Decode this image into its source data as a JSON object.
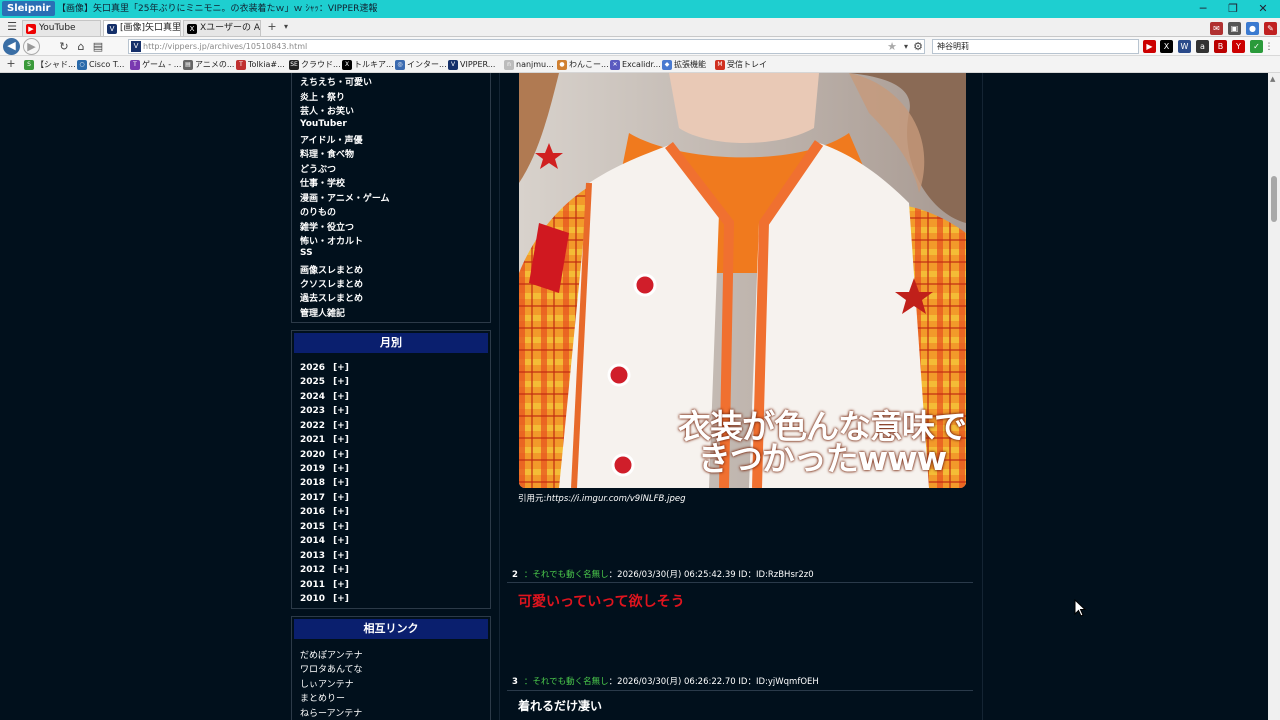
{
  "titlebar": {
    "app_name": "Sleipnir",
    "title": "【画像】矢口真里「25年ぶりにミニモニ。の衣装着たｗ」ｗ ｼｬｯ：VIPPER速報",
    "min": "─",
    "max": "❐",
    "close": "✕"
  },
  "tabs": [
    {
      "label": "YouTube",
      "active": false
    },
    {
      "label": "[画像]矢口真里...",
      "active": true
    },
    {
      "label": "Xユーザーの ABE...",
      "active": false
    }
  ],
  "tabbar": {
    "new_tab": "+",
    "menu": "▾"
  },
  "nav": {
    "url": "http://vippers.jp/archives/10510843.html",
    "search_value": "神谷明莉"
  },
  "bookmarks": [
    {
      "label": "【シャド..."
    },
    {
      "label": "Cisco T..."
    },
    {
      "label": "ゲーム - ..."
    },
    {
      "label": "アニメの..."
    },
    {
      "label": "Tolkia#..."
    },
    {
      "label": "クラウド..."
    },
    {
      "label": "トルキア..."
    },
    {
      "label": "インター..."
    },
    {
      "label": "VIPPER..."
    },
    {
      "label": "nanjmu..."
    },
    {
      "label": "わんこー..."
    },
    {
      "label": "Excalidr..."
    },
    {
      "label": "拡張機能"
    },
    {
      "label": "受信トレイ"
    }
  ],
  "sidebar": {
    "categories": [
      "えちえち・可愛い",
      "炎上・祭り",
      "芸人・お笑い",
      "YouTuber",
      "アイドル・声優",
      "料理・食べ物",
      "どうぶつ",
      "仕事・学校",
      "漫画・アニメ・ゲーム",
      "のりもの",
      "雑学・役立つ",
      "怖い・オカルト",
      "SS",
      "画像スレまとめ",
      "クソスレまとめ",
      "過去スレまとめ",
      "管理人雑記"
    ],
    "monthly_title": "月別",
    "expand_label": "[+]",
    "years": [
      "2026",
      "2025",
      "2024",
      "2023",
      "2022",
      "2021",
      "2020",
      "2019",
      "2018",
      "2017",
      "2016",
      "2015",
      "2014",
      "2013",
      "2012",
      "2011",
      "2010"
    ],
    "links_title": "相互リンク",
    "links": [
      "だめぽアンテナ",
      "ワロタあんてな",
      "しぃアンテナ",
      "まとめりー",
      "ねらーアンテナ"
    ]
  },
  "article": {
    "image_caption_line1": "衣装が色んな意味で",
    "image_caption_line2": "きつかったwww",
    "source_prefix": "引用元:",
    "source_url": "https://i.imgur.com/v9lNLFB.jpeg",
    "responses": [
      {
        "num": "2",
        "name": "：それでも動く名無し",
        "meta": "：2026/03/30(月) 06:25:42.39 ID：ID:RzBHsr2z0",
        "body": "可愛いっていって欲しそう",
        "body_color": "#e0141e"
      },
      {
        "num": "3",
        "name": "：それでも動く名無し",
        "meta": "：2026/03/30(月) 06:26:22.70 ID：ID:yjWqmfOEH",
        "body": "着れるだけ凄い",
        "body_color": "#ffffff"
      }
    ]
  },
  "colors": {
    "page_bg": "#01101c",
    "sidebar_header_bg": "#0a1f6e",
    "titlebar_bg": "#1ecfd0",
    "res_name": "#4ccc4c"
  }
}
